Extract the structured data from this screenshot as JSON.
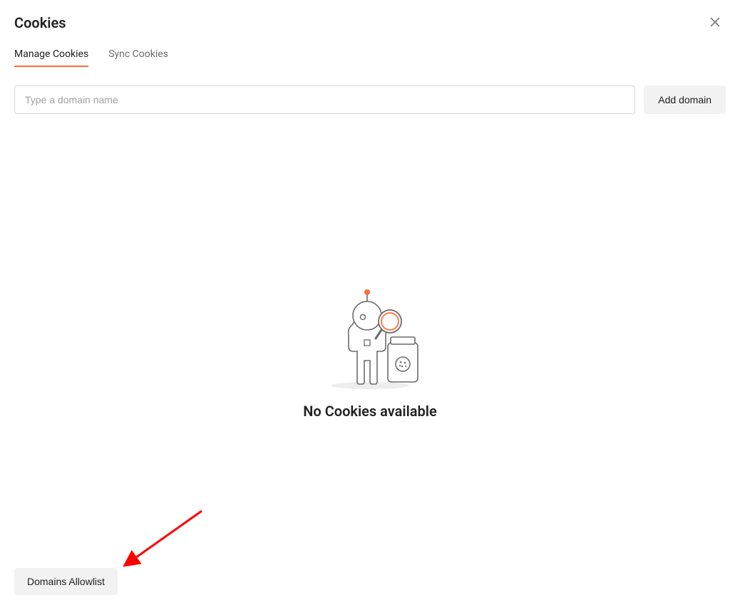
{
  "header": {
    "title": "Cookies"
  },
  "tabs": [
    {
      "label": "Manage Cookies",
      "active": true
    },
    {
      "label": "Sync Cookies",
      "active": false
    }
  ],
  "input": {
    "placeholder": "Type a domain name",
    "value": ""
  },
  "buttons": {
    "add_domain": "Add domain",
    "domains_allowlist": "Domains Allowlist"
  },
  "empty_state": {
    "title": "No Cookies available"
  },
  "colors": {
    "accent": "#ff6c37",
    "arrow": "#ff0000"
  },
  "annotation": {
    "type": "arrow",
    "points_to": "domains-allowlist-button"
  }
}
